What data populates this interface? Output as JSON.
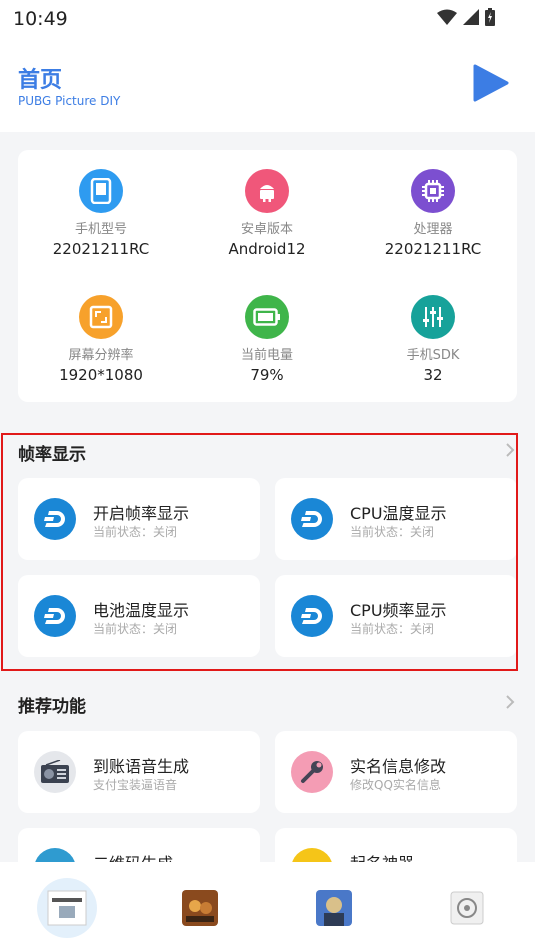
{
  "status": {
    "time": "10:49"
  },
  "header": {
    "title": "首页",
    "subtitle": "PUBG Picture DIY"
  },
  "device_info": [
    {
      "label": "手机型号",
      "value": "22021211RC",
      "icon": "phone-icon",
      "color": "#2e9bf0"
    },
    {
      "label": "安卓版本",
      "value": "Android12",
      "icon": "android-icon",
      "color": "#f0577a"
    },
    {
      "label": "处理器",
      "value": "22021211RC",
      "icon": "cpu-icon",
      "color": "#7c4fd0"
    },
    {
      "label": "屏幕分辨率",
      "value": "1920*1080",
      "icon": "screen-icon",
      "color": "#f7a12b"
    },
    {
      "label": "当前电量",
      "value": "79%",
      "icon": "battery-icon",
      "color": "#3fb54a"
    },
    {
      "label": "手机SDK",
      "value": "32",
      "icon": "sliders-icon",
      "color": "#17a29a"
    }
  ],
  "frame_section": {
    "title": "帧率显示",
    "items": [
      {
        "title": "开启帧率显示",
        "status": "当前状态：关闭"
      },
      {
        "title": "CPU温度显示",
        "status": "当前状态：关闭"
      },
      {
        "title": "电池温度显示",
        "status": "当前状态：关闭"
      },
      {
        "title": "CPU频率显示",
        "status": "当前状态：关闭"
      }
    ]
  },
  "recommend_section": {
    "title": "推荐功能",
    "items": [
      {
        "title": "到账语音生成",
        "sub": "支付宝装逼语音"
      },
      {
        "title": "实名信息修改",
        "sub": "修改QQ实名信息"
      },
      {
        "title": "二维码生成",
        "sub": ""
      },
      {
        "title": "起名神器",
        "sub": ""
      }
    ]
  },
  "colors": {
    "accent": "#3c7de4",
    "dash_icon": "#1a87d6",
    "highlight": "#e11919"
  }
}
